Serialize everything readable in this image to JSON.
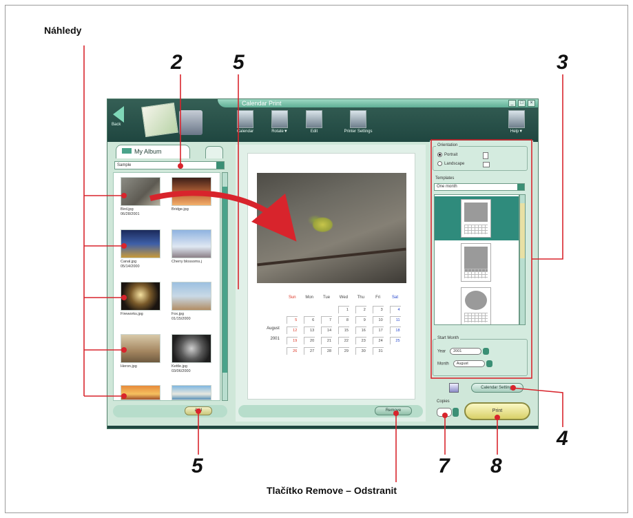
{
  "page": {
    "label_nahledy": "Náhledy",
    "label_remove": "Tlačítko Remove – Odstranit",
    "callouts": {
      "n2": "2",
      "n5_top": "5",
      "n3": "3",
      "n4": "4",
      "n5_bottom": "5",
      "n7": "7",
      "n8": "8"
    }
  },
  "app": {
    "title": "Calendar Print",
    "back_label": "Back",
    "toolbar": [
      {
        "label": "Calendar",
        "icon": "calendar-icon"
      },
      {
        "label": "Rotate▼",
        "icon": "rotate-icon"
      },
      {
        "label": "Edit",
        "icon": "edit-icon"
      },
      {
        "label": "Printer Settings",
        "icon": "printer-settings-icon"
      }
    ],
    "help_label": "Help▼",
    "left": {
      "tab_label": "My Album",
      "folder_value": "Sample",
      "thumbnails": [
        {
          "caption": "Bird.jpg\n06/28/2001"
        },
        {
          "caption": "Bridge.jpg"
        },
        {
          "caption": "Canal.jpg\n05/14/2000"
        },
        {
          "caption": "Cherry blossoms.j"
        },
        {
          "caption": "Fireworks.jpg"
        },
        {
          "caption": "Fox.jpg\n01/15/2000"
        },
        {
          "caption": "Heron.jpg"
        },
        {
          "caption": "Kettle.jpg\n03/06/2000"
        }
      ],
      "add_label": "Add"
    },
    "center": {
      "weekdays": [
        "Sun",
        "Mon",
        "Tue",
        "Wed",
        "Thu",
        "Fri",
        "Sat"
      ],
      "month": "August",
      "year": "2001",
      "weeks": [
        [
          "",
          "",
          "",
          "1",
          "2",
          "3",
          "4"
        ],
        [
          "5",
          "6",
          "7",
          "8",
          "9",
          "10",
          "11"
        ],
        [
          "12",
          "13",
          "14",
          "15",
          "16",
          "17",
          "18"
        ],
        [
          "19",
          "20",
          "21",
          "22",
          "23",
          "24",
          "25"
        ],
        [
          "26",
          "27",
          "28",
          "29",
          "30",
          "31",
          ""
        ]
      ],
      "remove_label": "Remove"
    },
    "right": {
      "orientation_title": "Orientation",
      "portrait_label": "Portrait",
      "landscape_label": "Landscape",
      "templates_title": "Templates",
      "template_value": "One month",
      "start_month_title": "Start Month",
      "year_label": "Year",
      "year_value": "2001",
      "month_label": "Month",
      "month_value": "August",
      "calendar_settings_label": "Calendar Settings",
      "copies_label": "Copies",
      "copies_value": "1",
      "print_label": "Print"
    }
  },
  "colors": {
    "callout_red": "#d8242c",
    "titlebar": "#1f4640",
    "panel_green": "#cfe7d9",
    "accent_teal": "#2f8b7c"
  }
}
